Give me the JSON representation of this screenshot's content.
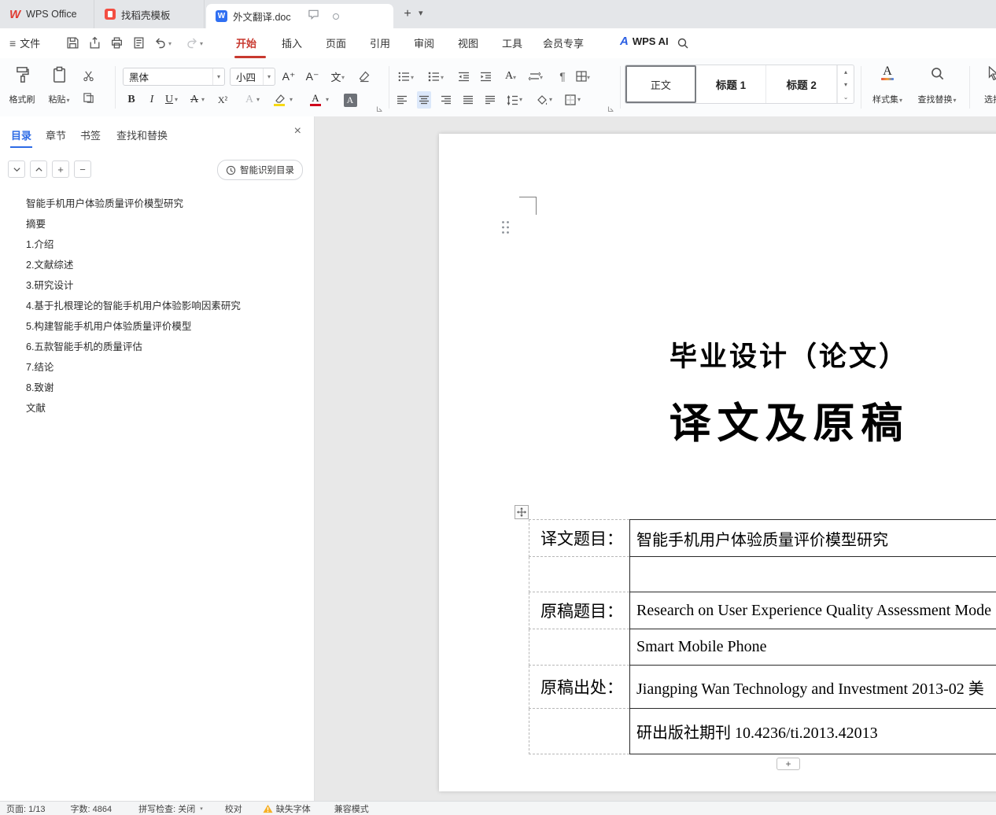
{
  "tabbar": {
    "tabs": [
      {
        "label": "WPS Office"
      },
      {
        "label": "找稻壳模板"
      },
      {
        "label": "外文翻译.doc"
      }
    ]
  },
  "menubar": {
    "file_label": "文件",
    "items": [
      "开始",
      "插入",
      "页面",
      "引用",
      "审阅",
      "视图",
      "工具",
      "会员专享"
    ],
    "wps_ai_label": "WPS AI"
  },
  "ribbon": {
    "format_painter": "格式刷",
    "paste": "粘贴",
    "font_name": "黑体",
    "font_size": "小四",
    "styles": [
      "正文",
      "标题 1",
      "标题 2"
    ],
    "style_set": "样式集",
    "find_replace": "查找替换",
    "select": "选择"
  },
  "sidebar": {
    "tabs": [
      "目录",
      "章节",
      "书签",
      "查找和替换"
    ],
    "smart_toc_button": "智能识别目录",
    "toc": [
      "智能手机用户体验质量评价模型研究",
      "摘要",
      "1.介绍",
      "2.文献综述",
      "3.研究设计",
      "4.基于扎根理论的智能手机用户体验影响因素研究",
      "5.构建智能手机用户体验质量评价模型",
      "6.五款智能手机的质量评估",
      "7.结论",
      "8.致谢",
      "文献"
    ]
  },
  "document": {
    "title_line1": "毕业设计（论文）",
    "title_line2": "译文及原稿",
    "table": {
      "rows": [
        {
          "label": "译文题目：",
          "value": "智能手机用户体验质量评价模型研究"
        },
        {
          "label": "",
          "value": ""
        },
        {
          "label": "原稿题目：",
          "value": "Research on User Experience Quality Assessment Mode"
        },
        {
          "label": "",
          "value": "Smart Mobile Phone"
        },
        {
          "label": "原稿出处：",
          "value": "Jiangping Wan Technology and Investment 2013-02  美"
        },
        {
          "label": "",
          "value": "研出版社期刊  10.4236/ti.2013.42013"
        }
      ]
    }
  },
  "statusbar": {
    "page": "页面: 1/13",
    "word_count": "字数: 4864",
    "spellcheck": "拼写检查: 关闭",
    "proofread": "校对",
    "missing_font": "缺失字体",
    "compat_mode": "兼容模式"
  },
  "icons": {
    "dropdown": "▾",
    "up": "▴",
    "more": "⌄",
    "plus": "+",
    "minus": "−",
    "close": "×",
    "hamburger": "≡",
    "bold": "B",
    "italic": "I",
    "underline": "U",
    "strike": "A",
    "superscript": "X²",
    "effect": "A",
    "font_color": "A",
    "shading": "A",
    "grow": "A⁺",
    "shrink": "A⁻",
    "phonetic": "文",
    "asian": "A",
    "pilcrow": "¶",
    "wps": "W",
    "docw": "W",
    "ai": "A"
  },
  "colors": {
    "accent_red": "#c8392f",
    "accent_blue": "#2d6be5",
    "warning": "#f6b026",
    "font_color_bar": "#d0021b",
    "highlight_bar": "#f7d914"
  }
}
